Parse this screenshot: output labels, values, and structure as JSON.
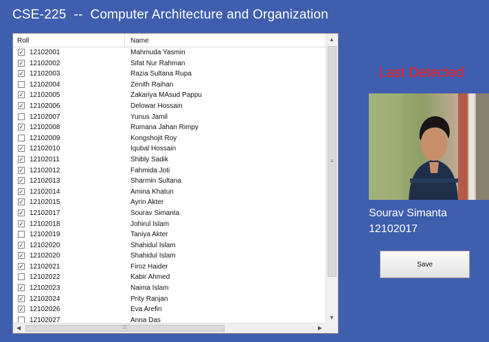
{
  "window": {
    "title": "CSE-225  --  Computer Architecture and Organization"
  },
  "attendance_table": {
    "columns": [
      "Roll",
      "Name"
    ],
    "rows": [
      {
        "checked": true,
        "roll": "12102001",
        "name": "Mahmuda Yasmin"
      },
      {
        "checked": true,
        "roll": "12102002",
        "name": "Sifat Nur Rahman"
      },
      {
        "checked": true,
        "roll": "12102003",
        "name": "Razia Sultana Rupa"
      },
      {
        "checked": false,
        "roll": "12102004",
        "name": "Zenith Raihan"
      },
      {
        "checked": true,
        "roll": "12102005",
        "name": "Zakariya MAsud Pappu"
      },
      {
        "checked": true,
        "roll": "12102006",
        "name": "Delowar Hossain"
      },
      {
        "checked": false,
        "roll": "12102007",
        "name": "Yunus Jamil"
      },
      {
        "checked": true,
        "roll": "12102008",
        "name": "Rumana Jahan Rimpy"
      },
      {
        "checked": false,
        "roll": "12102009",
        "name": "Kongshojit Roy"
      },
      {
        "checked": true,
        "roll": "12102010",
        "name": "Iqubal Hossain"
      },
      {
        "checked": true,
        "roll": "12102011",
        "name": "Shibly Sadik"
      },
      {
        "checked": true,
        "roll": "12102012",
        "name": "Fahmida Joti"
      },
      {
        "checked": true,
        "roll": "12102013",
        "name": "Sharmin Sultana"
      },
      {
        "checked": true,
        "roll": "12102014",
        "name": "Amina Khatun"
      },
      {
        "checked": true,
        "roll": "12102015",
        "name": "Ayrin Akter"
      },
      {
        "checked": true,
        "roll": "12102017",
        "name": "Sourav Simanta"
      },
      {
        "checked": true,
        "roll": "12102018",
        "name": "Johirul Islam"
      },
      {
        "checked": false,
        "roll": "12102019",
        "name": "Taniya Akter"
      },
      {
        "checked": true,
        "roll": "12102020",
        "name": "Shahidul Islam"
      },
      {
        "checked": true,
        "roll": "12102020",
        "name": "Shahidul Islam"
      },
      {
        "checked": true,
        "roll": "12102021",
        "name": "Firoz Haider"
      },
      {
        "checked": false,
        "roll": "12102022",
        "name": "Kabir Ahmed"
      },
      {
        "checked": true,
        "roll": "12102023",
        "name": "Naima Islam"
      },
      {
        "checked": true,
        "roll": "12102024",
        "name": "Prity Ranjan"
      },
      {
        "checked": true,
        "roll": "12102026",
        "name": "Eva Arefin"
      },
      {
        "checked": false,
        "roll": "12102027",
        "name": "Anna Das"
      }
    ]
  },
  "detection": {
    "heading": "Last Detected",
    "person_name": "Sourav Simanta",
    "person_roll": "12102017"
  },
  "save_button": {
    "label": "Save"
  },
  "icons": {
    "check": "checkmark-icon",
    "scroll_up": "scroll-up-arrow-icon",
    "scroll_down": "scroll-down-arrow-icon",
    "scroll_left": "scroll-left-arrow-icon",
    "scroll_right": "scroll-right-arrow-icon"
  },
  "colors": {
    "background": "#3f5ead",
    "heading_red": "#ff1a1a",
    "text_white": "#ffffff"
  }
}
